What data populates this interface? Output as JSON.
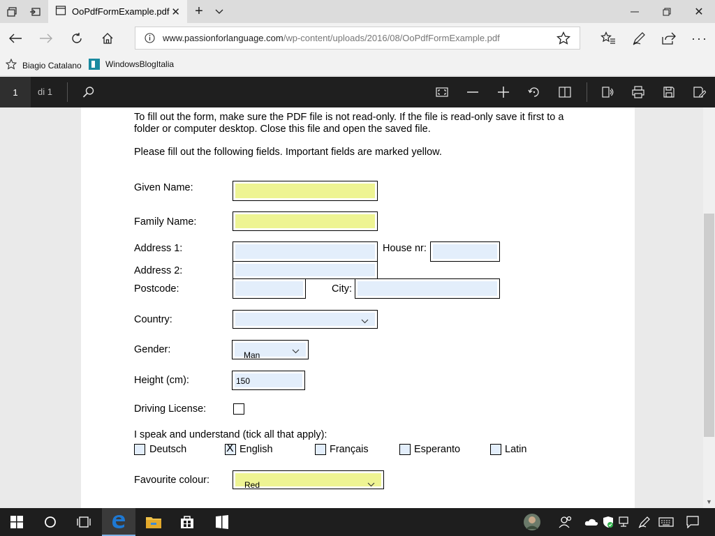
{
  "tab": {
    "title": "OoPdfFormExample.pdf"
  },
  "address": {
    "url_domain": "www.passionforlanguage.com",
    "url_path": "/wp-content/uploads/2016/08/OoPdfFormExample.pdf"
  },
  "favorites": [
    {
      "label": "Biagio Catalano",
      "icon": "star-outline-icon"
    },
    {
      "label": "WindowsBlogItalia",
      "icon": "site-favicon-icon"
    }
  ],
  "pdf_toolbar": {
    "page": "1",
    "page_of": "di 1"
  },
  "document": {
    "intro_line1": "To fill out the form, make sure the PDF file is not read-only. If the file is read-only save it first to a",
    "intro_line2": "folder or computer desktop. Close this file and open the saved file.",
    "intro_line3": "Please fill out the following fields. Important fields are marked yellow.",
    "labels": {
      "given_name": "Given Name:",
      "family_name": "Family Name:",
      "address1": "Address 1:",
      "house_nr": "House nr:",
      "address2": "Address 2:",
      "postcode": "Postcode:",
      "city": "City:",
      "country": "Country:",
      "gender": "Gender:",
      "height": "Height (cm):",
      "driving_license": "Driving License:",
      "languages": "I speak and understand (tick all that apply):",
      "favourite_colour": "Favourite colour:"
    },
    "values": {
      "given_name": "",
      "family_name": "",
      "address1": "",
      "house_nr": "",
      "address2": "",
      "postcode": "",
      "city": "",
      "country": "",
      "gender": "Man",
      "height": "150",
      "favourite_colour": "Red"
    },
    "languages": [
      {
        "label": "Deutsch",
        "checked": false
      },
      {
        "label": "English",
        "checked": true
      },
      {
        "label": "Français",
        "checked": false
      },
      {
        "label": "Esperanto",
        "checked": false
      },
      {
        "label": "Latin",
        "checked": false
      }
    ],
    "checkmark": "X"
  },
  "colors": {
    "required_field": "#eef493",
    "optional_field": "#e3eefb",
    "pdf_toolbar_bg": "#1f1f1f",
    "taskbar_bg": "#1e1e1e",
    "edge_blue": "#1e78d2"
  }
}
